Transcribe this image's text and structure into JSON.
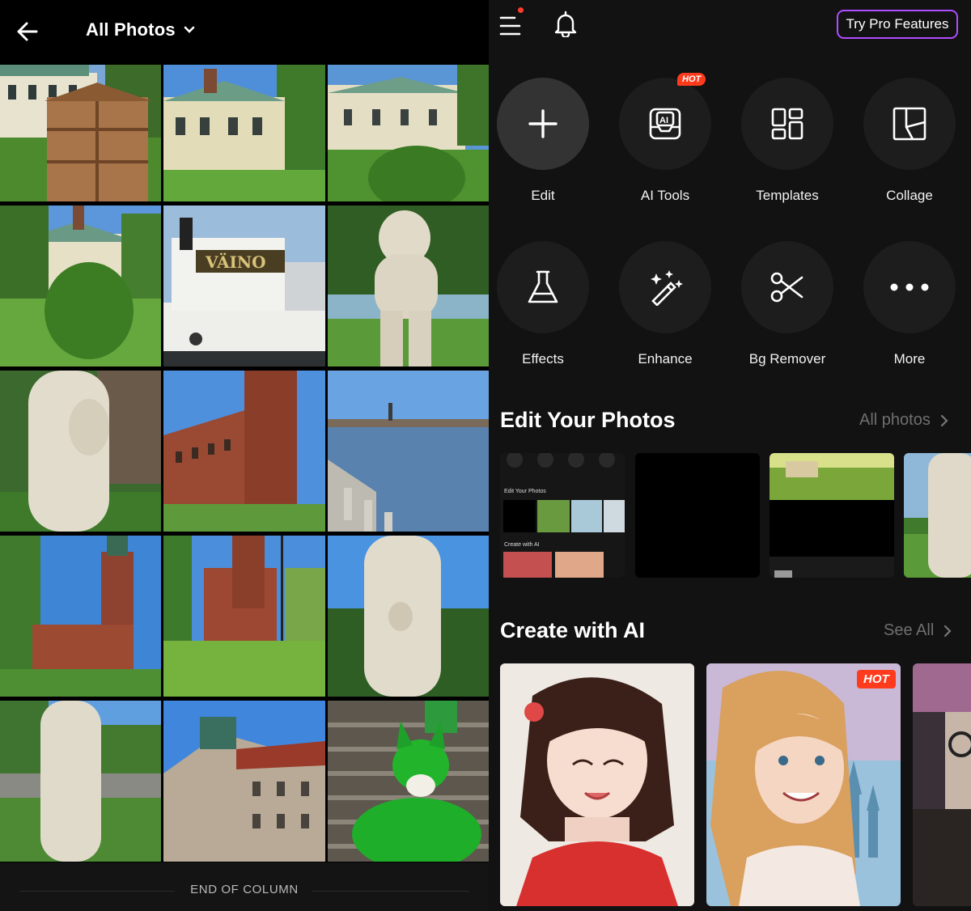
{
  "left": {
    "title": "All Photos",
    "back_icon": "arrow-left-icon",
    "dropdown_icon": "chevron-down-icon",
    "footer_text": "END OF COLUMN",
    "photos": [
      "palace-with-wooden-hut",
      "palace-yellow-facade",
      "palace-with-bush",
      "palace-with-tree",
      "steamboat-vaino",
      "marble-statue-fountain",
      "marble-statue-closeup",
      "city-hall-brick-facade",
      "waterfront-old-town-view",
      "city-hall-tower-lawn",
      "city-hall-garden",
      "marble-statue-lower",
      "marble-statue-park",
      "stone-building-low-angle",
      "green-cat-on-stairs"
    ]
  },
  "right": {
    "header": {
      "menu_icon": "hamburger-menu-icon",
      "bell_icon": "bell-icon",
      "pro_button": "Try Pro Features"
    },
    "tools": [
      {
        "label": "Edit",
        "icon": "plus-icon"
      },
      {
        "label": "AI Tools",
        "icon": "ai-inbox-icon",
        "badge": "HOT"
      },
      {
        "label": "Templates",
        "icon": "templates-grid-icon"
      },
      {
        "label": "Collage",
        "icon": "collage-icon"
      },
      {
        "label": "Effects",
        "icon": "flask-icon"
      },
      {
        "label": "Enhance",
        "icon": "magic-wand-icon"
      },
      {
        "label": "Bg Remover",
        "icon": "scissors-icon"
      },
      {
        "label": "More",
        "icon": "more-dots-icon"
      }
    ],
    "edit_section": {
      "title": "Edit Your Photos",
      "link": "All photos",
      "thumbs": [
        "app-screenshot-thumb",
        "black-image-thumb",
        "garden-screenshot-thumb",
        "statue-partial-thumb"
      ],
      "mini_labels": {
        "edit_title": "Edit Your Photos",
        "create_title": "Create with AI"
      }
    },
    "ai_section": {
      "title": "Create with AI",
      "link": "See All",
      "cards": [
        {
          "name": "anime-girl-red-dress"
        },
        {
          "name": "princess-castle",
          "badge": "HOT"
        },
        {
          "name": "partial-portrait"
        }
      ]
    }
  }
}
